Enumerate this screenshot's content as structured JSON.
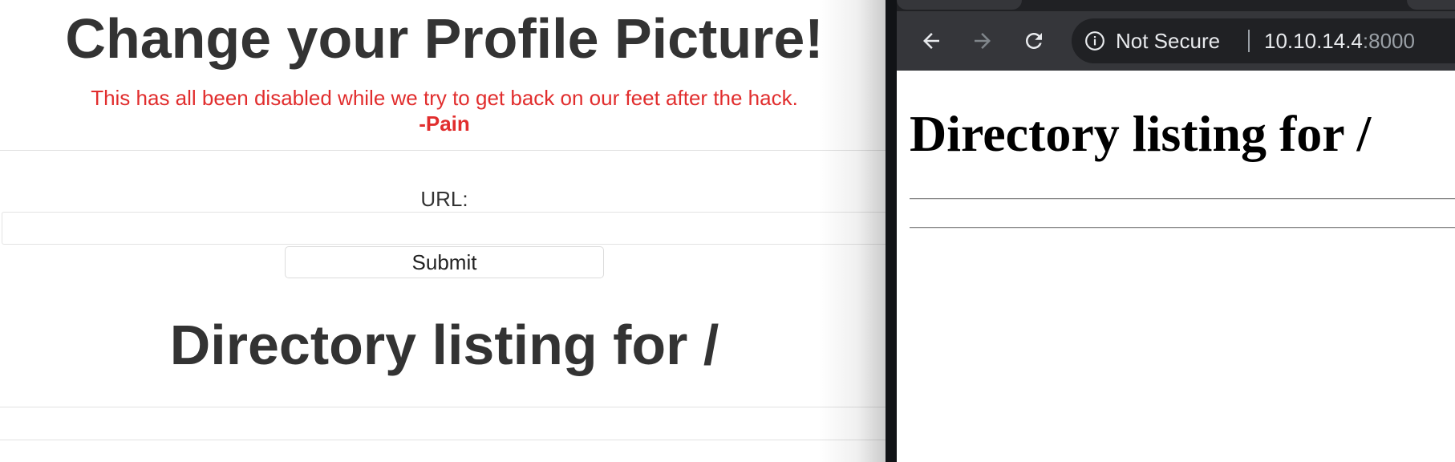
{
  "left_page": {
    "title": "Change your Profile Picture!",
    "notice": "This has all been disabled while we try to get back on our feet after the hack.",
    "signature": "-Pain",
    "url_label": "URL:",
    "url_value": "",
    "submit_label": "Submit",
    "listing_title": "Directory listing for /"
  },
  "browser": {
    "security_label": "Not Secure",
    "url_host": "10.10.14.4",
    "url_port": ":8000",
    "icons": [
      "back-arrow-icon",
      "forward-arrow-icon",
      "reload-icon",
      "info-icon"
    ],
    "content": {
      "listing_title": "Directory listing for /"
    }
  },
  "colors": {
    "notice_red": "#e12d2d",
    "heading_gray": "#333333",
    "chrome_toolbar": "#35363a",
    "chrome_omnibox": "#202124"
  }
}
